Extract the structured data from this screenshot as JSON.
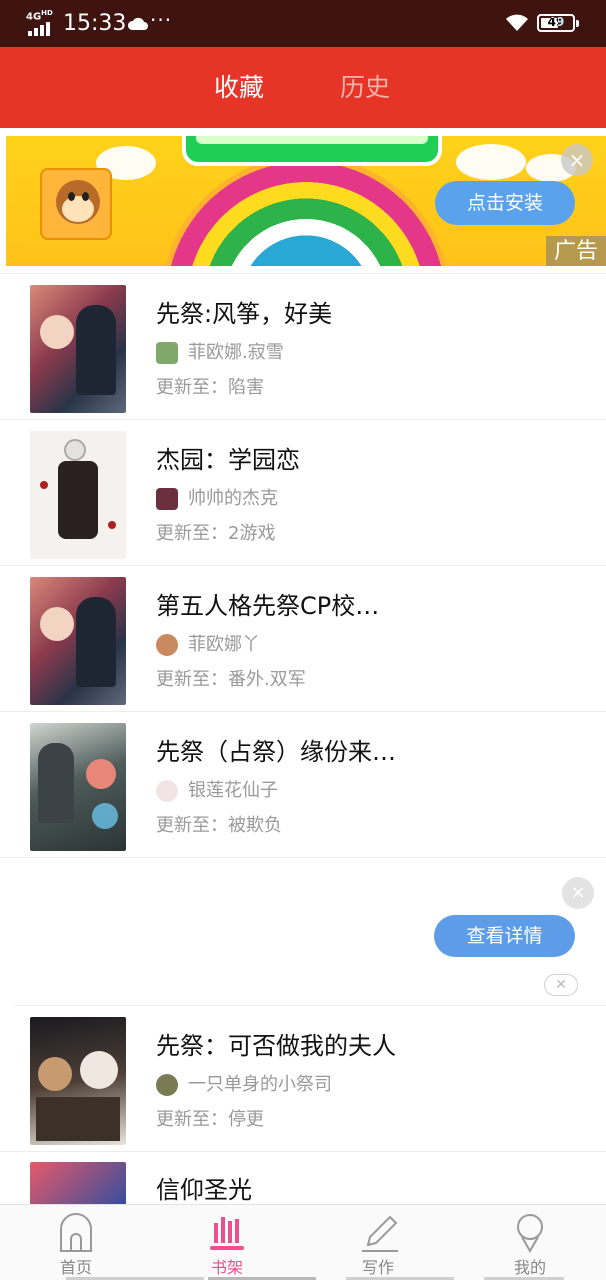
{
  "status_bar": {
    "network": "4G",
    "network_sup": "HD",
    "time": "15:33",
    "more": "···",
    "battery": "49"
  },
  "tabs": {
    "favorites": "收藏",
    "history": "历史"
  },
  "ad_banner": {
    "install_label": "点击安装",
    "ad_label": "广告",
    "close": "×"
  },
  "books": [
    {
      "title": "先祭:风筝，好美",
      "author": "菲欧娜.寂雪",
      "update": "更新至：陷害"
    },
    {
      "title": "杰园：学园恋",
      "author": "帅帅的杰克",
      "update": "更新至：2游戏"
    },
    {
      "title": "第五人格先祭CP校…",
      "author": "菲欧娜丫",
      "update": "更新至：番外.双军"
    },
    {
      "title": "先祭（占祭）缘份来…",
      "author": "银莲花仙子",
      "update": "更新至：被欺负"
    },
    {
      "title": "先祭：可否做我的夫人",
      "author": "一只单身的小祭司",
      "update": "更新至：停更"
    },
    {
      "title": "信仰圣光",
      "author": "",
      "update": ""
    }
  ],
  "ad_card": {
    "details_label": "查看详情",
    "close": "×",
    "dismiss": "✕"
  },
  "bottom_nav": {
    "home": "首页",
    "bookshelf": "书架",
    "write": "写作",
    "mine": "我的"
  },
  "colors": {
    "header_red": "#e63427",
    "status_bar": "#3f1410",
    "accent_pink": "#ee4f8e",
    "button_blue": "#5d9de8"
  }
}
